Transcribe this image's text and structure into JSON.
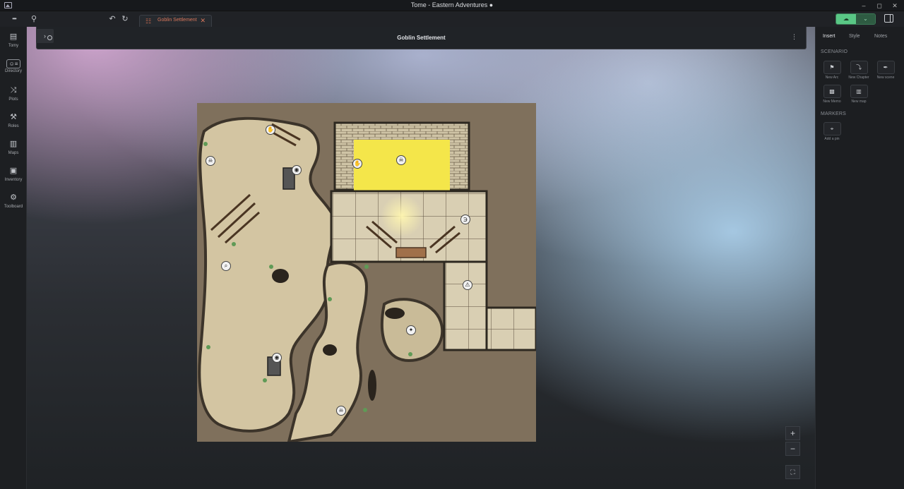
{
  "window": {
    "title": "Tome - Eastern Adventures ●"
  },
  "toolbar": {
    "more_glyph": "•••",
    "search_glyph": "⚲",
    "undo_glyph": "↶",
    "redo_glyph": "↻",
    "tab": {
      "label": "Goblin Settlement",
      "icon_glyph": "☷",
      "close_glyph": "✕"
    },
    "sync_glyph": "☁",
    "sync_menu_glyph": "⌄"
  },
  "sidebar": {
    "items": [
      {
        "label": "Tomy",
        "icon": "book-icon",
        "glyph": "▤"
      },
      {
        "label": "Directory",
        "icon": "contact-card-icon",
        "glyph": "☺≡"
      },
      {
        "label": "Plots",
        "icon": "shuffle-icon",
        "glyph": "⤨"
      },
      {
        "label": "Roles",
        "icon": "roles-icon",
        "glyph": "⚒"
      },
      {
        "label": "Maps",
        "icon": "map-icon",
        "glyph": "▥"
      },
      {
        "label": "Inventory",
        "icon": "inventory-icon",
        "glyph": "▣"
      },
      {
        "label": "Toolboard",
        "icon": "toolboard-icon",
        "glyph": "⚙"
      }
    ]
  },
  "document": {
    "title": "Goblin Settlement",
    "expand_glyph": "›",
    "menu_glyph": "⋮",
    "map_pins": [
      {
        "icon": "hand-icon",
        "glyph": "✋"
      },
      {
        "icon": "skull-icon",
        "glyph": "☠"
      },
      {
        "icon": "eye-icon",
        "glyph": "◉"
      },
      {
        "icon": "hand-icon",
        "glyph": "✋"
      },
      {
        "icon": "skull-icon",
        "glyph": "☠"
      },
      {
        "icon": "ear-icon",
        "glyph": "℈"
      },
      {
        "icon": "magnifier-icon",
        "glyph": "⌕"
      },
      {
        "icon": "warning-icon",
        "glyph": "⚠"
      },
      {
        "icon": "crosshair-icon",
        "glyph": "✦"
      },
      {
        "icon": "eye-icon",
        "glyph": "◉"
      },
      {
        "icon": "skull-icon",
        "glyph": "☠"
      }
    ]
  },
  "map_controls": {
    "zoom_in": "+",
    "zoom_out": "−",
    "fit": "⛶"
  },
  "right_panel": {
    "tabs": [
      "Insert",
      "Style",
      "Notes"
    ],
    "scenario_heading": "SCENARIO",
    "scenario_buttons": [
      {
        "label": "New Arc",
        "icon": "bookmark-icon",
        "glyph": "⚑"
      },
      {
        "label": "New Chapter",
        "icon": "chapter-icon",
        "glyph": "⤵"
      },
      {
        "label": "New scene",
        "icon": "feather-icon",
        "glyph": "✒"
      },
      {
        "label": "New Memo",
        "icon": "memo-icon",
        "glyph": "▩"
      },
      {
        "label": "New map",
        "icon": "map-icon",
        "glyph": "▥"
      }
    ],
    "markers_heading": "MARKERS",
    "markers_buttons": [
      {
        "label": "Add a pin",
        "icon": "pin-icon",
        "glyph": "⌖"
      }
    ]
  },
  "colors": {
    "accent": "#d9775c",
    "sync_green": "#59c785",
    "torch_yellow": "#f4e64a"
  }
}
